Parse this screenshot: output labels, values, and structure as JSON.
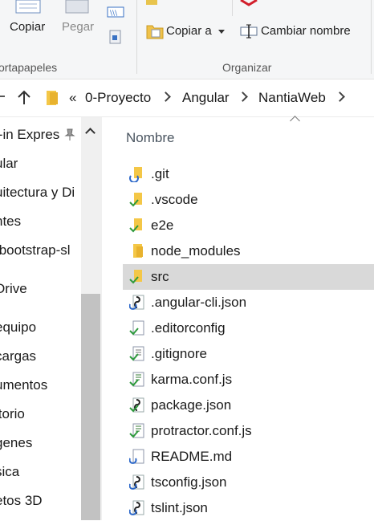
{
  "ribbon": {
    "copy_label": "Copiar",
    "paste_label": "Pegar",
    "copy_to_label": "Copiar a",
    "rename_label": "Cambiar nombre",
    "clipboard_group": "ortapapeles",
    "organize_group": "Organizar"
  },
  "address": {
    "prefix": "«",
    "crumbs": [
      "0-Proyecto",
      "Angular",
      "NantiaWeb"
    ]
  },
  "nav": {
    "items": [
      "l-in Expres",
      "ular",
      "uitectura y Di",
      "ntes",
      "tbootstrap-sl",
      "Drive",
      "equipo",
      "cargas",
      "umentos",
      "itorio",
      "genes",
      "sica",
      "etos 3D"
    ]
  },
  "files": {
    "column_name": "Nombre",
    "items": [
      {
        "name": ".git",
        "icon": "folder-sync-icon"
      },
      {
        "name": ".vscode",
        "icon": "folder-synced-icon"
      },
      {
        "name": "e2e",
        "icon": "folder-synced-icon"
      },
      {
        "name": "node_modules",
        "icon": "folder-icon"
      },
      {
        "name": "src",
        "icon": "folder-synced-icon",
        "selected": true
      },
      {
        "name": ".angular-cli.json",
        "icon": "json-file-icon"
      },
      {
        "name": ".editorconfig",
        "icon": "file-synced-icon"
      },
      {
        "name": ".gitignore",
        "icon": "text-file-synced-icon"
      },
      {
        "name": "karma.conf.js",
        "icon": "js-file-synced-icon"
      },
      {
        "name": "package.json",
        "icon": "json-file-synced-icon"
      },
      {
        "name": "protractor.conf.js",
        "icon": "js-file-synced-icon"
      },
      {
        "name": "README.md",
        "icon": "file-sync-icon"
      },
      {
        "name": "tsconfig.json",
        "icon": "json-file-icon"
      },
      {
        "name": "tslint.json",
        "icon": "json-file-icon"
      }
    ]
  }
}
